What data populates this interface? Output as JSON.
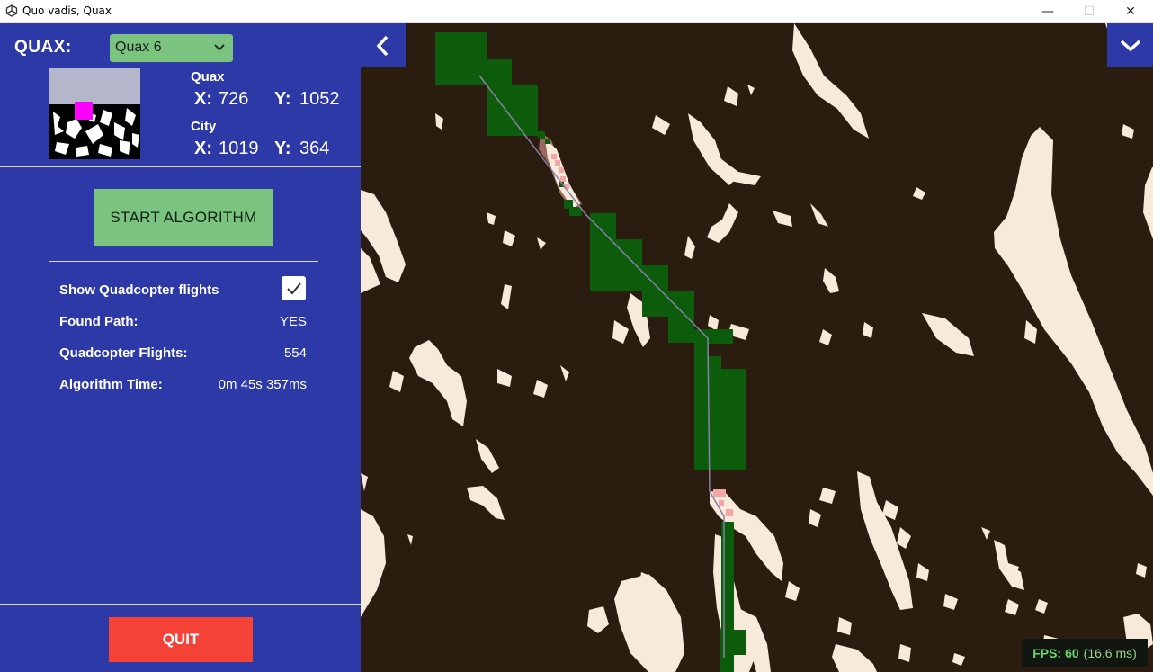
{
  "window": {
    "title": "Quo vadis, Quax",
    "minimize": "—",
    "maximize": "☐",
    "close": "✕"
  },
  "panel": {
    "quax_label": "QUAX:",
    "quax_select": {
      "value": "Quax 6"
    },
    "quax_coords": {
      "title": "Quax",
      "x_label": "X:",
      "x_value": "726",
      "y_label": "Y:",
      "y_value": "1052"
    },
    "city_coords": {
      "title": "City",
      "x_label": "X:",
      "x_value": "1019",
      "y_label": "Y:",
      "y_value": "364"
    },
    "start_button": "START ALGORITHM",
    "show_flights_label": "Show Quadcopter flights",
    "show_flights_checked": true,
    "found_path_label": "Found Path:",
    "found_path_value": "YES",
    "flights_label": "Quadcopter Flights:",
    "flights_value": "554",
    "time_label": "Algorithm Time:",
    "time_value": "0m 45s 357ms",
    "quit_button": "QUIT"
  },
  "map": {
    "fps_label": "FPS:",
    "fps_value": "60",
    "fps_ms": "(16.6 ms)"
  },
  "colors": {
    "panel": "#2c39a6",
    "accent_green": "#7bc47f",
    "quit_red": "#f44336",
    "water": "#2a1d0f",
    "land": "#f7eadb",
    "path_green": "#0c5c0c",
    "visited_pink": "#f4a6a6",
    "path_line": "#8a7fa8"
  },
  "icons": [
    "unity-logo-icon",
    "chevron-down-icon",
    "chevron-left-icon",
    "checkmark-icon"
  ]
}
